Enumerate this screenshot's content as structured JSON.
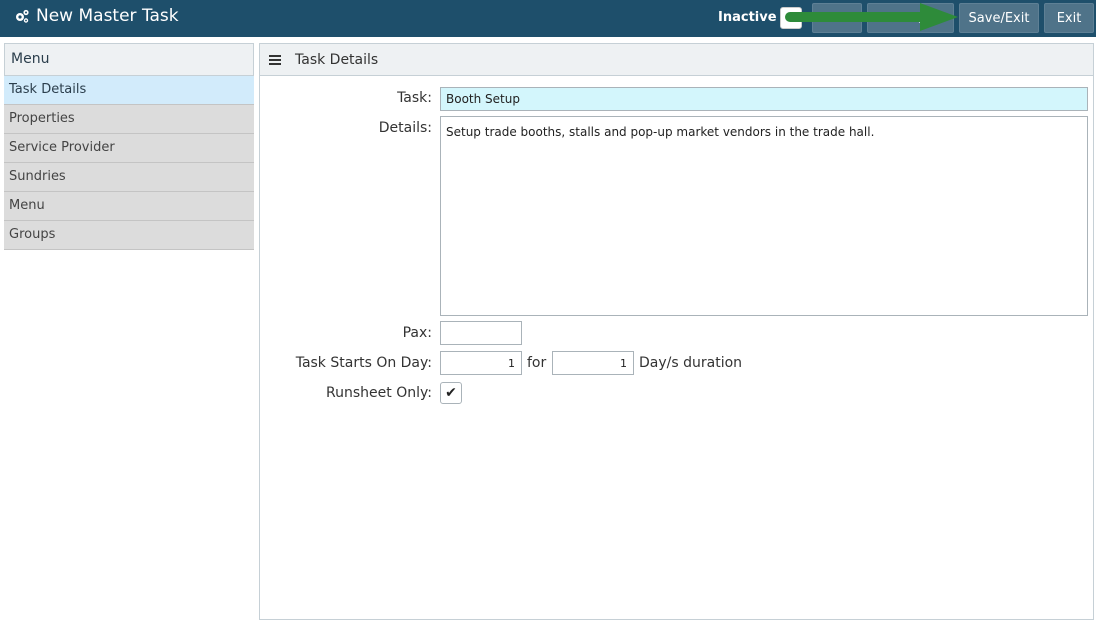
{
  "header": {
    "title": "New Master Task",
    "inactive_label": "Inactive",
    "buttons": {
      "save": "Save",
      "save_plus": "Save/+",
      "save_exit": "Save/Exit",
      "exit": "Exit"
    },
    "icon": "cogs-icon"
  },
  "menu": {
    "title": "Menu",
    "items": [
      {
        "label": "Task Details",
        "active": true
      },
      {
        "label": "Properties"
      },
      {
        "label": "Service Provider"
      },
      {
        "label": "Sundries"
      },
      {
        "label": "Menu"
      },
      {
        "label": "Groups"
      }
    ]
  },
  "content": {
    "title": "Task Details",
    "labels": {
      "task": "Task:",
      "details": "Details:",
      "pax": "Pax:",
      "starts": "Task Starts On Day:",
      "for": "for",
      "duration": "Day/s duration",
      "runsheet": "Runsheet Only:"
    },
    "values": {
      "task": "Booth Setup",
      "details": "Setup trade booths, stalls and pop-up market vendors in the trade hall.",
      "pax": "",
      "start_day": "1",
      "duration_days": "1",
      "runsheet_only": "✔"
    }
  },
  "colors": {
    "topbar": "#1e4f6b",
    "button": "#4f7389",
    "active_menu": "#d2ebfb",
    "task_input": "#d3f6fc",
    "arrow": "#2e8b3a"
  }
}
